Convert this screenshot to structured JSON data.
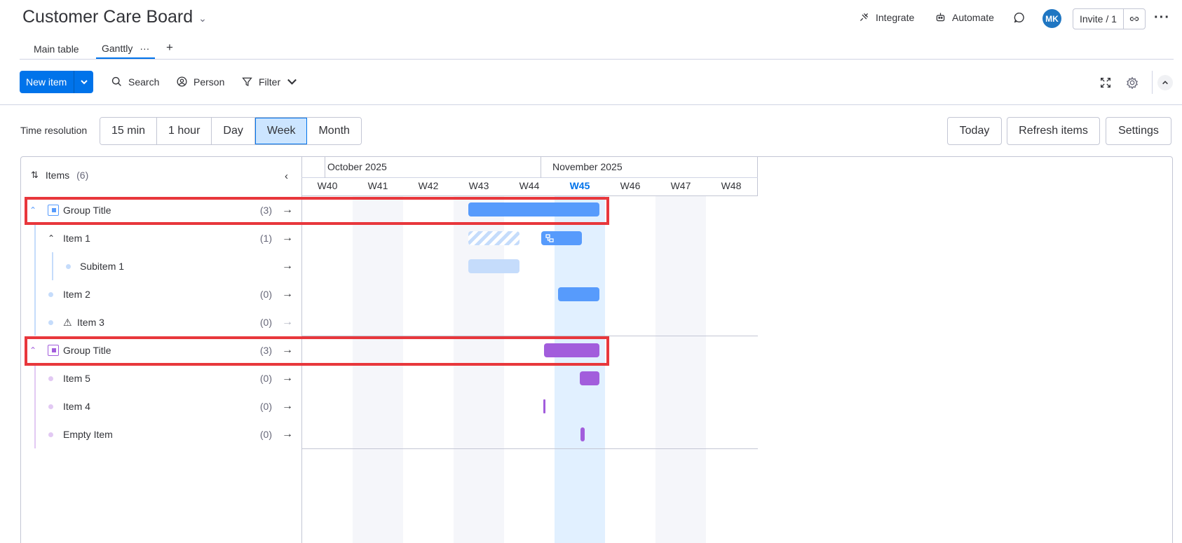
{
  "board": {
    "title": "Customer Care Board"
  },
  "header": {
    "integrate_label": "Integrate",
    "automate_label": "Automate",
    "avatar_initials": "MK",
    "invite_label": "Invite / 1"
  },
  "tabs": [
    {
      "label": "Main table"
    },
    {
      "label": "Ganttly",
      "menu": "···"
    }
  ],
  "toolbar": {
    "new_item_label": "New item",
    "search_label": "Search",
    "person_label": "Person",
    "filter_label": "Filter"
  },
  "time_resolution": {
    "label": "Time resolution",
    "options": [
      "15 min",
      "1 hour",
      "Day",
      "Week",
      "Month"
    ],
    "selected": "Week"
  },
  "actions": {
    "today_label": "Today",
    "refresh_label": "Refresh items",
    "settings_label": "Settings"
  },
  "items_panel": {
    "label": "Items",
    "count": "(6)"
  },
  "timeline": {
    "months": [
      "October 2025",
      "November 2025"
    ],
    "weeks": [
      "W40",
      "W41",
      "W42",
      "W43",
      "W44",
      "W45",
      "W46",
      "W47",
      "W48"
    ],
    "current_week": "W45"
  },
  "groups": [
    {
      "title": "Group Title",
      "count": "(3)",
      "color": "#579bfc",
      "rows": [
        {
          "name": "Item 1",
          "count": "(1)"
        },
        {
          "name": "Subitem 1",
          "count": ""
        },
        {
          "name": "Item 2",
          "count": "(0)"
        },
        {
          "name": "Item 3",
          "count": "(0)",
          "warning": true
        }
      ]
    },
    {
      "title": "Group Title",
      "count": "(3)",
      "color": "#a25ddc",
      "rows": [
        {
          "name": "Item 5",
          "count": "(0)"
        },
        {
          "name": "Item 4",
          "count": "(0)"
        },
        {
          "name": "Empty Item",
          "count": "(0)"
        }
      ]
    }
  ],
  "colors": {
    "accent": "#0073ea",
    "group1": "#579bfc",
    "group2": "#a25ddc",
    "highlight": "#e8373c"
  }
}
